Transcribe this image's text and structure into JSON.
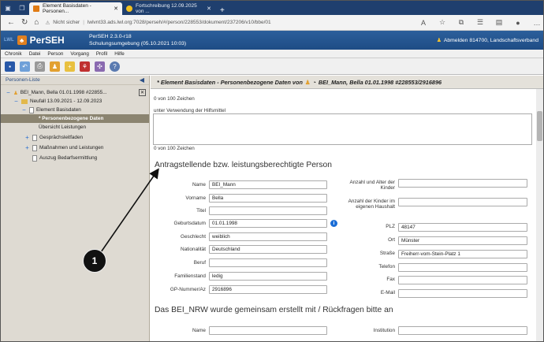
{
  "browser": {
    "tabs": [
      {
        "title": "Element Basisdaten - Personen...",
        "active": true
      },
      {
        "title": "Fortschreibung 12.09.2025 von ...",
        "active": false
      }
    ],
    "security_label": "Nicht sicher",
    "url": "lwlvnt33.ads.lwl.org:7028/perseh/#/person/228553/dokument/237206/v10/bbe/01"
  },
  "app": {
    "logo_prefix": "LWL",
    "name": "PerSEH",
    "version": "PerSEH 2.3.0-r18",
    "environment": "Schulungsumgebung (05.10.2021 10:03)",
    "logout": "Abmelden 814700, Landschaftsverband"
  },
  "menu": [
    "Chronik",
    "Datei",
    "Person",
    "Vorgang",
    "Profil",
    "Hilfe"
  ],
  "sidebar": {
    "title": "Personen-Liste",
    "tree": [
      {
        "label": "BEI_Mann, Bella 01.01.1998 #22855...",
        "indent": 0
      },
      {
        "label": "Neufall 13.09.2021 - 12.09.2023",
        "indent": 1
      },
      {
        "label": "Element Basisdaten",
        "indent": 2
      },
      {
        "label": "* Personenbezogene Daten",
        "indent": 3
      },
      {
        "label": "Übersicht Leistungen",
        "indent": 3
      },
      {
        "label": "Gesprächsleitfaden",
        "indent": 2
      },
      {
        "label": "Maßnahmen und Leistungen",
        "indent": 2
      },
      {
        "label": "Auszug Bedarfsermittlung",
        "indent": 2
      }
    ]
  },
  "content": {
    "title": "* Element Basisdaten - Personenbezogene Daten von",
    "title_person": "BEI_Mann, Bella 01.01.1998 #228553/2916896",
    "counter1": "0 von 100 Zeichen",
    "hilfsmittel_label": "unter Verwendung der Hilfsmittel",
    "counter2": "0 von 100 Zeichen",
    "section1": "Antragstellende bzw. leistungsberechtigte Person",
    "section2": "Das BEI_NRW wurde gemeinsam erstellt mit / Rückfragen bitte an",
    "left_fields": [
      {
        "label": "Name",
        "value": "BEI_Mann"
      },
      {
        "label": "Vorname",
        "value": "Bella"
      },
      {
        "label": "Titel",
        "value": ""
      },
      {
        "label": "Geburtsdatum",
        "value": "01.01.1998"
      },
      {
        "label": "Geschlecht",
        "value": "weiblich"
      },
      {
        "label": "Nationalität",
        "value": "Deutschland"
      },
      {
        "label": "Beruf",
        "value": ""
      },
      {
        "label": "Familienstand",
        "value": "ledig"
      },
      {
        "label": "GP-Nummer/Az",
        "value": "2916896"
      }
    ],
    "right_fields": [
      {
        "label": "Anzahl und Alter der Kinder",
        "value": ""
      },
      {
        "label": "Anzahl der Kinder im eigenen Haushalt",
        "value": ""
      },
      {
        "label": "PLZ",
        "value": "48147"
      },
      {
        "label": "Ort",
        "value": "Münster"
      },
      {
        "label": "Straße",
        "value": "Freiherr-vom-Stein-Platz 1"
      },
      {
        "label": "Telefon",
        "value": ""
      },
      {
        "label": "Fax",
        "value": ""
      },
      {
        "label": "E-Mail",
        "value": ""
      }
    ],
    "bottom_left_label": "Name",
    "bottom_right_label": "Institution",
    "info_icon": "i"
  },
  "annotation": {
    "number": "1"
  },
  "colors": {
    "header_blue": "#1e4c85",
    "selected_tree": "#8b8470",
    "sidebar_bg": "#dedad2"
  }
}
